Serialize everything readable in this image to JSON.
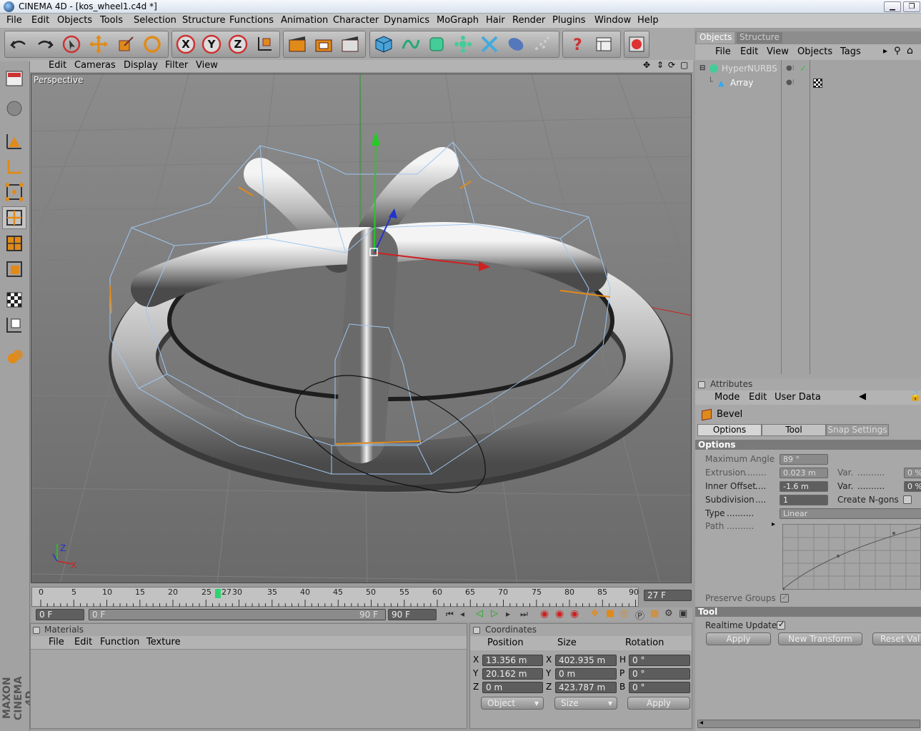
{
  "window": {
    "title": "CINEMA 4D - [kos_wheel1.c4d *]"
  },
  "menu": [
    "File",
    "Edit",
    "Objects",
    "Tools",
    "Selection",
    "Structure",
    "Functions",
    "Animation",
    "Character",
    "Dynamics",
    "MoGraph",
    "Hair",
    "Render",
    "Plugins",
    "Window",
    "Help"
  ],
  "toolbar": {
    "icons": [
      "undo-icon",
      "redo-icon",
      "live-selection-icon",
      "move-icon",
      "scale-icon",
      "rotate-icon",
      "x-axis-icon",
      "y-axis-icon",
      "z-axis-icon",
      "world-coords-icon",
      "render-view-icon",
      "render-region-icon",
      "render-picture-viewer-icon",
      "cube-icon",
      "spline-icon",
      "nurbs-icon",
      "array-icon",
      "deformer-icon",
      "scene-icon",
      "particle-icon",
      "help-icon",
      "layout-icon",
      "browser-icon"
    ],
    "axis_labels": [
      "X",
      "Y",
      "Z"
    ]
  },
  "left_tools": [
    "viewport-layout-icon",
    "object-mode-icon",
    "model-tool-icon",
    "axis-tool-icon",
    "point-mode-icon",
    "edge-mode-icon",
    "polygon-mode-icon",
    "uv-mode-icon",
    "texture-mode-icon",
    "workplane-icon",
    "object-axis-icon"
  ],
  "brand": {
    "line1": "MAXON",
    "line2": "CINEMA 4D"
  },
  "viewport": {
    "menu": [
      "Edit",
      "Cameras",
      "Display",
      "Filter",
      "View"
    ],
    "label": "Perspective",
    "axis_gizmo": {
      "z": "Z",
      "x": "X"
    }
  },
  "timeline": {
    "ticks": [
      "0",
      "5",
      "10",
      "15",
      "20",
      "25",
      "27",
      "30",
      "35",
      "40",
      "45",
      "50",
      "55",
      "60",
      "65",
      "70",
      "75",
      "80",
      "85",
      "90"
    ],
    "current_frame": "27 F"
  },
  "playback": {
    "start": "0 F",
    "range_start": "0 F",
    "range_end": "90 F",
    "end": "90 F"
  },
  "objects_panel": {
    "tabs": [
      "Objects",
      "Structure"
    ],
    "menu": [
      "File",
      "Edit",
      "View",
      "Objects",
      "Tags"
    ],
    "items": [
      {
        "name": "HyperNURBS"
      },
      {
        "name": "Array"
      }
    ]
  },
  "attributes_panel": {
    "title": "Attributes",
    "menu": [
      "Mode",
      "Edit",
      "User Data"
    ],
    "tool_name": "Bevel",
    "tabs": [
      "Options",
      "Tool",
      "Snap Settings"
    ],
    "section_options": "Options",
    "fields": {
      "max_angle_label": "Maximum Angle",
      "max_angle_value": "89 °",
      "extrusion_label": "Extrusion",
      "extrusion_value": "0.023 m",
      "inner_offset_label": "Inner Offset",
      "inner_offset_value": "-1.6 m",
      "subdivision_label": "Subdivision",
      "subdivision_value": "1",
      "type_label": "Type",
      "type_value": "Linear",
      "path_label": "Path",
      "var_label": "Var.",
      "var_value": "0 %",
      "create_ngons_label": "Create N-gons",
      "preserve_groups_label": "Preserve Groups"
    },
    "section_tool": "Tool",
    "realtime_update_label": "Realtime Update",
    "buttons": {
      "apply": "Apply",
      "new_transform": "New Transform",
      "reset_values": "Reset Val"
    }
  },
  "materials_panel": {
    "title": "Materials",
    "menu": [
      "File",
      "Edit",
      "Function",
      "Texture"
    ]
  },
  "coordinates_panel": {
    "title": "Coordinates",
    "headers": {
      "position": "Position",
      "size": "Size",
      "rotation": "Rotation"
    },
    "rows": [
      {
        "axis": "X",
        "pos": "13.356 m",
        "size_axis": "X",
        "size": "402.935 m",
        "rot_axis": "H",
        "rot": "0 °"
      },
      {
        "axis": "Y",
        "pos": "20.162 m",
        "size_axis": "Y",
        "size": "0 m",
        "rot_axis": "P",
        "rot": "0 °"
      },
      {
        "axis": "Z",
        "pos": "0 m",
        "size_axis": "Z",
        "size": "423.787 m",
        "rot_axis": "B",
        "rot": "0 °"
      }
    ],
    "mode_select": "Object",
    "size_select": "Size",
    "apply": "Apply"
  },
  "colors": {
    "accent_orange": "#e08a1a",
    "selection_blue": "#9ec6f0",
    "axis_red": "#cc2222",
    "axis_green": "#22aa22",
    "axis_blue": "#2233cc"
  }
}
